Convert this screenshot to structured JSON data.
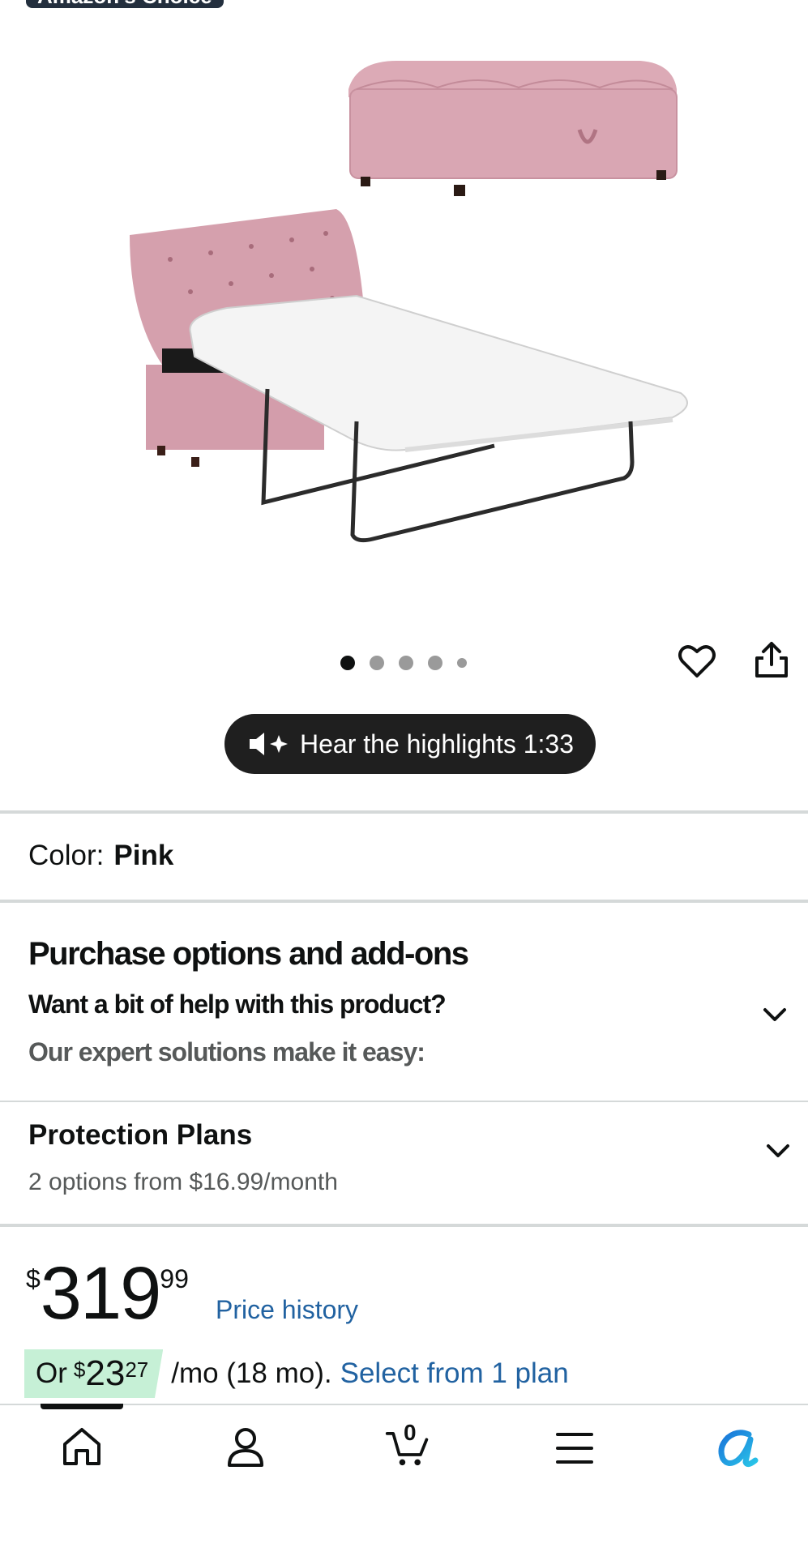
{
  "badge": {
    "label": "Amazon's Choice"
  },
  "image_carousel": {
    "total_dots": 5,
    "active_index": 0
  },
  "audio": {
    "label": "Hear the highlights 1:33"
  },
  "color": {
    "label": "Color:",
    "value": "Pink"
  },
  "purchase_options": {
    "title": "Purchase options and add-ons",
    "help_line": "Want a bit of help with this product?",
    "expert_line": "Our expert solutions make it easy:"
  },
  "protection": {
    "title": "Protection Plans",
    "subtitle": "2 options from $16.99/month"
  },
  "price": {
    "symbol": "$",
    "whole": "319",
    "fraction": "99",
    "history_link": "Price history"
  },
  "installment": {
    "prefix": "Or",
    "symbol": "$",
    "whole": "23",
    "fraction": "27",
    "rest": "/mo (18 mo).",
    "link": "Select from 1 plan"
  },
  "bottom_nav": {
    "cart_count": "0",
    "items": [
      "home-icon",
      "account-icon",
      "cart-icon",
      "menu-icon",
      "rufus-icon"
    ]
  },
  "colors": {
    "accent_link": "#2162a1",
    "installment_bg": "#c6f0d6",
    "pill_bg": "#1f1f1f",
    "product_pink": "#d9a7b4"
  }
}
